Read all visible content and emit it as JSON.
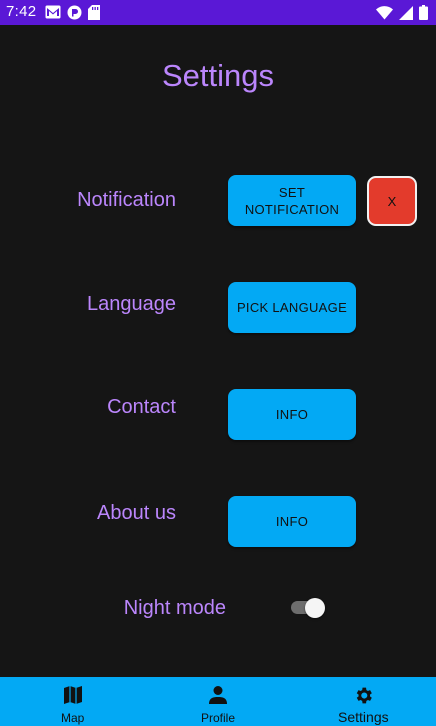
{
  "status_bar": {
    "time": "7:42",
    "icons": [
      "gmail-icon",
      "pocket-icon",
      "sd-card-icon",
      "wifi-icon",
      "signal-icon",
      "battery-icon"
    ],
    "background": "#5a18d6"
  },
  "page": {
    "title": "Settings",
    "accent": "#bb86fc",
    "background": "#151515"
  },
  "settings": {
    "notification": {
      "label": "Notification",
      "button": "SET NOTIFICATION",
      "clear_button": "X"
    },
    "language": {
      "label": "Language",
      "button": "PICK LANGUAGE"
    },
    "contact": {
      "label": "Contact",
      "button": "INFO"
    },
    "about": {
      "label": "About us",
      "button": "INFO"
    },
    "night_mode": {
      "label": "Night mode",
      "enabled": true
    }
  },
  "colors": {
    "button": "#03a9f4",
    "danger": "#e33b2c"
  },
  "bottom_nav": {
    "items": [
      {
        "label": "Map",
        "icon": "map-icon"
      },
      {
        "label": "Profile",
        "icon": "person-icon"
      },
      {
        "label": "Settings",
        "icon": "gear-icon"
      }
    ],
    "active": "Settings"
  }
}
